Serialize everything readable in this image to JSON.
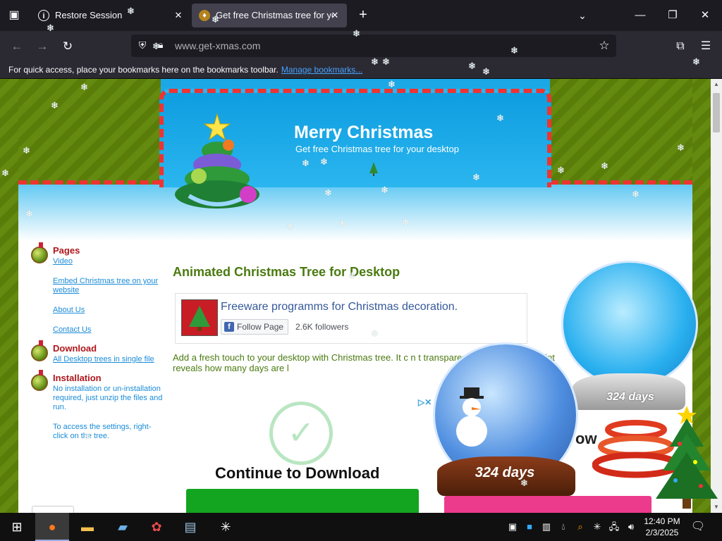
{
  "browser": {
    "tabs": [
      {
        "label": "Restore Session",
        "icon": "info-icon"
      },
      {
        "label": "Get free Christmas tree for your",
        "icon": "xmas-favicon"
      }
    ],
    "url": "www.get-xmas.com",
    "bookmarks_text": "For quick access, place your bookmarks here on the bookmarks toolbar.",
    "bookmarks_link": "Manage bookmarks..."
  },
  "site": {
    "title": "Merry Christmas",
    "subtitle": "Get free Christmas tree for your desktop"
  },
  "sidebar": {
    "pages_heading": "Pages",
    "pages_links": [
      "Video",
      "Embed Christmas tree on your website",
      "About Us",
      "Contact Us"
    ],
    "download_heading": "Download",
    "download_link": "All Desktop trees in single file",
    "installation_heading": "Installation",
    "installation_text1": "No installation or un-installation required, just unzip the files and run.",
    "installation_text2": "To access the settings, right-click on the tree."
  },
  "main": {
    "heading": "Animated Christmas Tree for Desktop",
    "fb_name": "Freeware programms for Christmas decoration.",
    "fb_follow": "Follow Page",
    "fb_followers": "2.6K followers",
    "intro": "Add a fresh touch to your desktop with Christmas tree. It c                                    n    t transparency - a mouseover hint reveals how many days are l"
  },
  "ad": {
    "title": "Continue to Download",
    "ow": "ow"
  },
  "globes": {
    "days1": "324 days",
    "days2": "324 days"
  },
  "taskbar": {
    "time": "12:40 PM",
    "date": "2/3/2025"
  },
  "colors": {
    "accent_green": "#4a7a10",
    "link_blue": "#1a8cd8",
    "heading_red": "#b0151b",
    "header_blue": "#1aa7e6"
  }
}
